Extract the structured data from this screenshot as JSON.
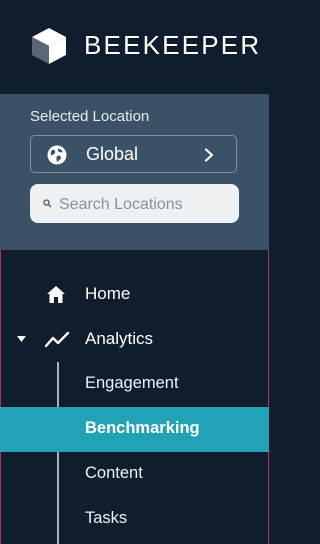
{
  "brand": {
    "name": "BEEKEEPER",
    "logo_icon": "cube-logo-icon"
  },
  "location": {
    "label": "Selected Location",
    "selected": "Global",
    "globe_icon": "globe-icon",
    "chevron_icon": "chevron-right-icon",
    "search_placeholder": "Search Locations"
  },
  "nav": {
    "items": [
      {
        "label": "Home",
        "icon": "home-icon"
      },
      {
        "label": "Analytics",
        "icon": "analytics-icon",
        "expanded": true,
        "children": [
          {
            "label": "Engagement",
            "active": false
          },
          {
            "label": "Benchmarking",
            "active": true
          },
          {
            "label": "Content",
            "active": false
          },
          {
            "label": "Tasks",
            "active": false
          }
        ]
      }
    ]
  },
  "colors": {
    "background": "#0f1d2c",
    "panel": "#3b5166",
    "active": "#21a3b5",
    "search_bg": "#eef1f3"
  }
}
